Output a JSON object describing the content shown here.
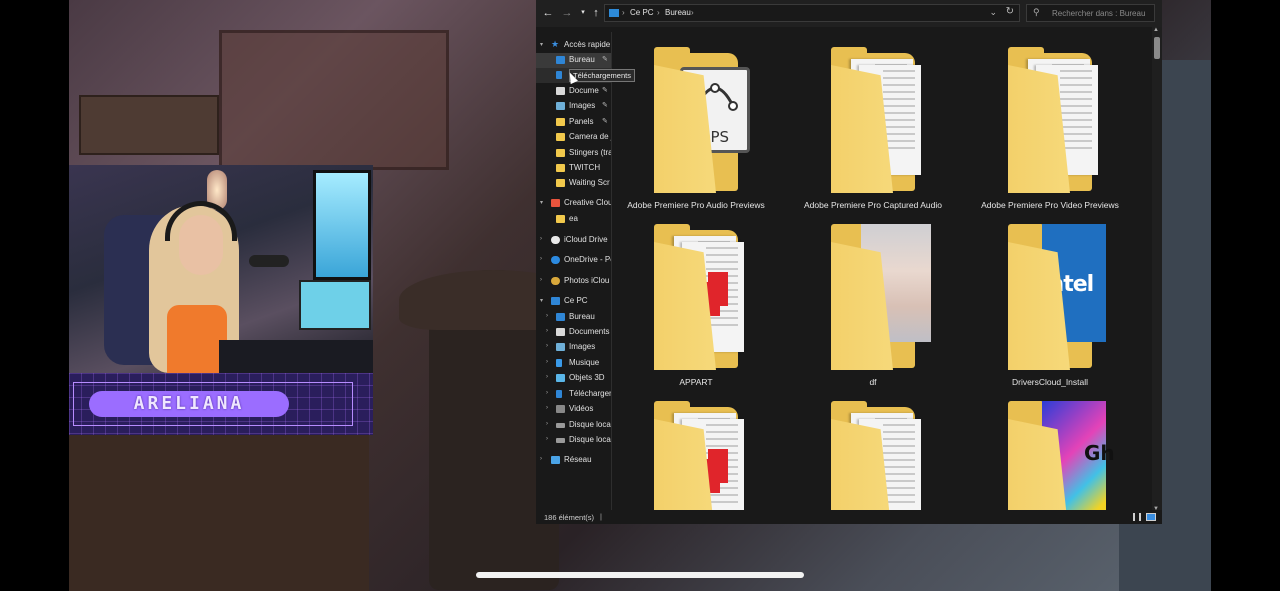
{
  "stream": {
    "name_tag": "ARELIANA"
  },
  "explorer": {
    "address": {
      "crumbs": [
        "Ce PC",
        "Bureau"
      ]
    },
    "search": {
      "placeholder": "Rechercher dans : Bureau"
    },
    "tooltip": "Téléchargements",
    "nav": [
      {
        "label": "Accès rapide",
        "icon": "star-icon",
        "level": 0,
        "expanded": true
      },
      {
        "label": "Bureau",
        "icon": "desktop-folder-icon",
        "level": 1,
        "pinned": true,
        "selected": true
      },
      {
        "label": "Téléchargements",
        "icon": "download-icon",
        "level": 1,
        "pinned": true,
        "hover": true
      },
      {
        "label": "Docume",
        "icon": "documents-icon",
        "level": 1,
        "pinned": true
      },
      {
        "label": "Images",
        "icon": "pictures-icon",
        "level": 1,
        "pinned": true
      },
      {
        "label": "Panels",
        "icon": "folder-icon",
        "level": 1,
        "pinned": true
      },
      {
        "label": "Camera de j",
        "icon": "folder-icon",
        "level": 1
      },
      {
        "label": "Stingers (tra",
        "icon": "folder-icon",
        "level": 1
      },
      {
        "label": "TWITCH",
        "icon": "folder-icon",
        "level": 1
      },
      {
        "label": "Waiting Scr",
        "icon": "folder-icon",
        "level": 1
      },
      {
        "label": "Creative Cloud",
        "icon": "creative-cloud-icon",
        "level": 0,
        "expanded": true
      },
      {
        "label": "ea",
        "icon": "folder-icon",
        "level": 1
      },
      {
        "label": "iCloud Drive",
        "icon": "icloud-icon",
        "level": 0
      },
      {
        "label": "OneDrive - Pe",
        "icon": "onedrive-icon",
        "level": 0
      },
      {
        "label": "Photos iClou",
        "icon": "photos-icon",
        "level": 0
      },
      {
        "label": "Ce PC",
        "icon": "pc-icon",
        "level": 0,
        "expanded": true
      },
      {
        "label": "Bureau",
        "icon": "desktop-folder-icon",
        "level": 1
      },
      {
        "label": "Documents",
        "icon": "documents-icon",
        "level": 1
      },
      {
        "label": "Images",
        "icon": "pictures-icon",
        "level": 1
      },
      {
        "label": "Musique",
        "icon": "music-icon",
        "level": 1
      },
      {
        "label": "Objets 3D",
        "icon": "objects-3d-icon",
        "level": 1
      },
      {
        "label": "Téléchargen",
        "icon": "download-icon",
        "level": 1
      },
      {
        "label": "Vidéos",
        "icon": "videos-icon",
        "level": 1
      },
      {
        "label": "Disque loca",
        "icon": "drive-icon",
        "level": 1
      },
      {
        "label": "Disque loca",
        "icon": "drive-icon",
        "level": 1
      },
      {
        "label": "Réseau",
        "icon": "network-icon",
        "level": 0
      }
    ],
    "items": [
      {
        "name": "Adobe Premiere Pro Audio Previews",
        "preview": "eps"
      },
      {
        "name": "Adobe Premiere Pro Captured Audio",
        "preview": "papers"
      },
      {
        "name": "Adobe Premiere Pro Video Previews",
        "preview": "papers"
      },
      {
        "name": "APPART",
        "preview": "pdf"
      },
      {
        "name": "df",
        "preview": "photo"
      },
      {
        "name": "DriversCloud_Install",
        "preview": "intel"
      },
      {
        "name": "",
        "preview": "pdf"
      },
      {
        "name": "",
        "preview": "papers"
      },
      {
        "name": "",
        "preview": "neon"
      }
    ],
    "previews": {
      "eps_label": "EPS",
      "pdf_label": "PDF",
      "intel_label": "intel",
      "neon_label": "Gh"
    },
    "status": {
      "count": "186 élément(s)"
    }
  }
}
